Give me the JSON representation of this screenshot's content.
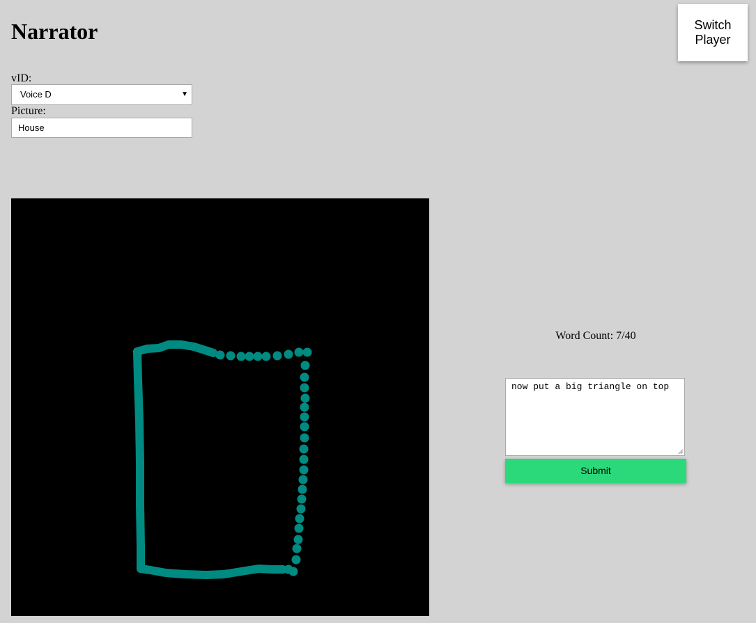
{
  "header": {
    "title": "Narrator",
    "switch_player_label": "Switch\nPlayer"
  },
  "form": {
    "vid_label": "vID:",
    "vid_selected": "Voice D",
    "picture_label": "Picture:",
    "picture_value": "House"
  },
  "canvas": {
    "background": "#000000",
    "stroke_color": "#008b82"
  },
  "panel": {
    "word_count": "Word Count: 7/40",
    "message": "now put a big triangle on top",
    "submit_label": "Submit",
    "submit_color": "#2bd97a"
  },
  "icons": {
    "select_arrow": "chevron-down-icon",
    "resize_grip": "resize-grip-icon"
  },
  "colors": {
    "page_background": "#d3d3d3"
  }
}
